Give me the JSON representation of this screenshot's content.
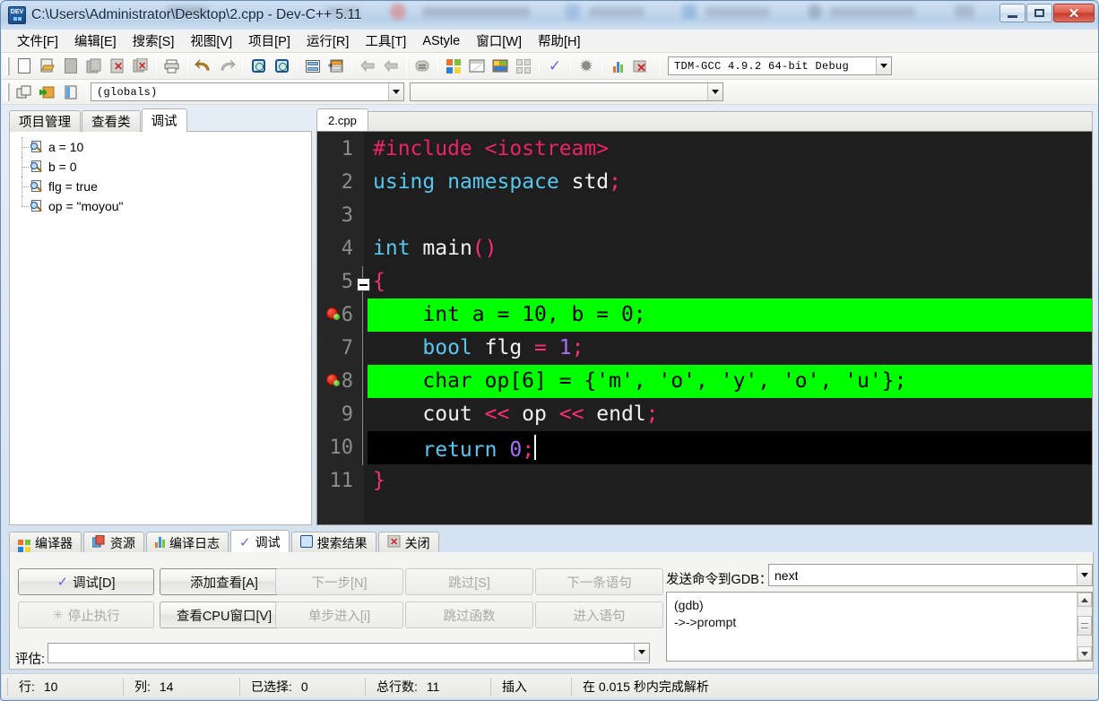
{
  "window": {
    "title": "C:\\Users\\Administrator\\Desktop\\2.cpp - Dev-C++ 5.11",
    "app_icon": "dev-cpp-icon",
    "minimize_label": "",
    "maximize_label": "",
    "close_label": "✕"
  },
  "menubar": {
    "items": [
      {
        "label": "文件[F]"
      },
      {
        "label": "编辑[E]"
      },
      {
        "label": "搜索[S]"
      },
      {
        "label": "视图[V]"
      },
      {
        "label": "项目[P]"
      },
      {
        "label": "运行[R]"
      },
      {
        "label": "工具[T]"
      },
      {
        "label": "AStyle"
      },
      {
        "label": "窗口[W]"
      },
      {
        "label": "帮助[H]"
      }
    ]
  },
  "toolbar": {
    "compiler_select": "TDM-GCC 4.9.2 64-bit Debug",
    "scope_select": "(globals)",
    "icons": [
      "new-file-icon",
      "open-file-icon",
      "save-icon",
      "save-all-icon",
      "close-file-icon",
      "close-all-icon",
      "print-icon",
      "undo-icon",
      "redo-icon",
      "find-icon",
      "replace-icon",
      "goto-line-icon",
      "goto-function-icon",
      "back-icon",
      "forward-icon",
      "unindent-icon",
      "compile-icon",
      "run-icon",
      "compile-run-icon",
      "rebuild-icon",
      "check-syntax-icon",
      "stop-icon",
      "profile-icon",
      "debug-icon"
    ],
    "row2_icons": [
      "new-project-icon",
      "add-to-project-icon",
      "project-options-icon"
    ]
  },
  "left_panel": {
    "tabs": [
      {
        "label": "项目管理",
        "active": false
      },
      {
        "label": "查看类",
        "active": false
      },
      {
        "label": "调试",
        "active": true
      }
    ],
    "watches": [
      {
        "icon": "watch-icon",
        "label": "a = 10"
      },
      {
        "icon": "watch-icon",
        "label": "b = 0"
      },
      {
        "icon": "watch-icon",
        "label": "flg = true"
      },
      {
        "icon": "watch-icon",
        "label": "op = \"moyou\""
      }
    ]
  },
  "editor": {
    "tab_label": "2.cpp",
    "lines": [
      {
        "num": "1",
        "state": "normal",
        "breakpoint": false,
        "tokens": [
          {
            "t": "#include ",
            "c": "pp"
          },
          {
            "t": "<iostream>",
            "c": "pp"
          }
        ]
      },
      {
        "num": "2",
        "state": "normal",
        "breakpoint": false,
        "tokens": [
          {
            "t": "using",
            "c": "k"
          },
          {
            "t": " ",
            "c": "w"
          },
          {
            "t": "namespace",
            "c": "k"
          },
          {
            "t": " ",
            "c": "w"
          },
          {
            "t": "std",
            "c": "w"
          },
          {
            "t": ";",
            "c": "pk"
          }
        ]
      },
      {
        "num": "3",
        "state": "normal",
        "breakpoint": false,
        "tokens": []
      },
      {
        "num": "4",
        "state": "normal",
        "breakpoint": false,
        "tokens": [
          {
            "t": "int",
            "c": "k"
          },
          {
            "t": " ",
            "c": "w"
          },
          {
            "t": "main",
            "c": "w"
          },
          {
            "t": "()",
            "c": "pk"
          }
        ]
      },
      {
        "num": "5",
        "state": "normal",
        "breakpoint": false,
        "fold": true,
        "tokens": [
          {
            "t": "{",
            "c": "pk"
          }
        ]
      },
      {
        "num": "6",
        "state": "highlight",
        "breakpoint": true,
        "tokens": [
          {
            "t": "    int a = 10, b = 0;",
            "c": "blk"
          }
        ]
      },
      {
        "num": "7",
        "state": "normal",
        "breakpoint": false,
        "tokens": [
          {
            "t": "    ",
            "c": "w"
          },
          {
            "t": "bool",
            "c": "k"
          },
          {
            "t": " flg ",
            "c": "w"
          },
          {
            "t": "=",
            "c": "pk"
          },
          {
            "t": " ",
            "c": "w"
          },
          {
            "t": "1",
            "c": "num"
          },
          {
            "t": ";",
            "c": "pk"
          }
        ]
      },
      {
        "num": "8",
        "state": "highlight",
        "breakpoint": true,
        "tokens": [
          {
            "t": "    char op[6] = {'m', 'o', 'y', 'o', 'u'};",
            "c": "blk"
          }
        ]
      },
      {
        "num": "9",
        "state": "normal",
        "breakpoint": false,
        "tokens": [
          {
            "t": "    cout ",
            "c": "w"
          },
          {
            "t": "<<",
            "c": "pk"
          },
          {
            "t": " op ",
            "c": "w"
          },
          {
            "t": "<<",
            "c": "pk"
          },
          {
            "t": " endl",
            "c": "w"
          },
          {
            "t": ";",
            "c": "pk"
          }
        ]
      },
      {
        "num": "10",
        "state": "current",
        "breakpoint": false,
        "cursor": true,
        "tokens": [
          {
            "t": "    ",
            "c": "w"
          },
          {
            "t": "return",
            "c": "k"
          },
          {
            "t": " ",
            "c": "w"
          },
          {
            "t": "0",
            "c": "num"
          },
          {
            "t": ";",
            "c": "pk"
          }
        ]
      },
      {
        "num": "11",
        "state": "normal",
        "breakpoint": false,
        "tokens": [
          {
            "t": "}",
            "c": "pk"
          }
        ]
      }
    ],
    "colors": {
      "background": "#1e1e1e",
      "gutter": "#262626",
      "highlight": "#00ff00",
      "current_line": "#000000",
      "keyword": "#57c7ef",
      "preprocessor": "#ee2266",
      "punctuation": "#ff2d78",
      "number": "#a96ef5",
      "identifier": "#f2f2f2",
      "line_number": "#8c8c8c"
    }
  },
  "bottom_panel": {
    "tabs": [
      {
        "label": "编译器",
        "icon": "compiler-icon",
        "active": false
      },
      {
        "label": "资源",
        "icon": "resource-icon",
        "active": false
      },
      {
        "label": "编译日志",
        "icon": "build-log-icon",
        "active": false
      },
      {
        "label": "调试",
        "icon": "debug-check-icon",
        "active": true
      },
      {
        "label": "搜索结果",
        "icon": "search-result-icon",
        "active": false
      },
      {
        "label": "关闭",
        "icon": "close-panel-icon",
        "active": false
      }
    ],
    "buttons": [
      {
        "label": "调试[D]",
        "accel": "D",
        "disabled": false,
        "icon": "check-icon"
      },
      {
        "label": "添加查看[A]",
        "accel": "A",
        "disabled": false,
        "icon": ""
      },
      {
        "label": "下一步[N]",
        "accel": "N",
        "disabled": true,
        "icon": ""
      },
      {
        "label": "跳过[S]",
        "accel": "S",
        "disabled": true,
        "icon": ""
      },
      {
        "label": "下一条语句",
        "accel": "",
        "disabled": true,
        "icon": ""
      },
      {
        "label": "停止执行",
        "accel": "",
        "disabled": true,
        "icon": "stop-icon"
      },
      {
        "label": "查看CPU窗口[V]",
        "accel": "V",
        "disabled": false,
        "icon": ""
      },
      {
        "label": "单步进入[i]",
        "accel": "i",
        "disabled": true,
        "icon": ""
      },
      {
        "label": "跳过函数",
        "accel": "",
        "disabled": true,
        "icon": ""
      },
      {
        "label": "进入语句",
        "accel": "",
        "disabled": true,
        "icon": ""
      }
    ],
    "eval_label": "评估:",
    "eval_value": "",
    "gdb_label": "发送命令到GDB：",
    "gdb_command": "next",
    "gdb_console": [
      "(gdb)",
      "->->prompt"
    ]
  },
  "statusbar": {
    "cells": [
      {
        "label": "行:",
        "value": "10"
      },
      {
        "label": "列:",
        "value": "14"
      },
      {
        "label": "已选择:",
        "value": "0"
      },
      {
        "label": "总行数:",
        "value": "11"
      },
      {
        "label": "插入",
        "value": ""
      },
      {
        "label": "在 0.015 秒内完成解析",
        "value": ""
      }
    ]
  }
}
